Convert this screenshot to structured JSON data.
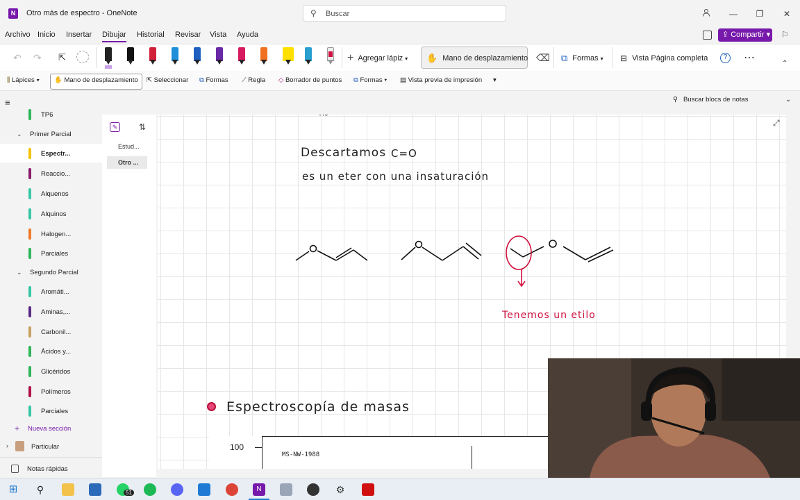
{
  "window": {
    "title": "Otro más de espectro - OneNote",
    "search_placeholder": "Buscar"
  },
  "menu": {
    "items": [
      "Archivo",
      "Inicio",
      "Insertar",
      "Dibujar",
      "Historial",
      "Revisar",
      "Vista",
      "Ayuda"
    ],
    "active": "Dibujar",
    "share_label": "Compartir"
  },
  "ribbon": {
    "add_pen": "Agregar lápiz",
    "hand": "Mano de desplazamiento",
    "shapes": "Formas",
    "full_page": "Vista Página completa",
    "pens": [
      {
        "color": "#222222"
      },
      {
        "color": "#111111"
      },
      {
        "color": "#d0203a"
      },
      {
        "color": "#1e8fd8"
      },
      {
        "color": "#1f5fbf"
      },
      {
        "color": "#6a2aa8"
      },
      {
        "color": "#d81b60"
      },
      {
        "color": "#f07020"
      },
      {
        "color": "#ffe000"
      },
      {
        "color": "#2aa0d0"
      },
      {
        "color": "#d01040"
      }
    ]
  },
  "quick_access": {
    "pencils": "Lápices",
    "hand": "Mano de desplazamiento",
    "select": "Seleccionar",
    "shapes": "Formas",
    "ruler": "Regla",
    "point_eraser": "Borrador de puntos",
    "shapes2": "Formas",
    "print_preview": "Vista previa de impresión"
  },
  "nav": {
    "search_notebooks": "Buscar blocs de notas"
  },
  "sidebar": {
    "top_item": {
      "label": "TP6",
      "color": "#2fb55a"
    },
    "group1": "Primer Parcial",
    "group1_items": [
      {
        "label": "Espectr...",
        "color": "#f2c200",
        "selected": true
      },
      {
        "label": "Reaccio...",
        "color": "#8a1a6b"
      },
      {
        "label": "Alquenos",
        "color": "#38c7a6"
      },
      {
        "label": "Alquinos",
        "color": "#38c7a6"
      },
      {
        "label": "Halogen...",
        "color": "#f07a2a"
      },
      {
        "label": "Parciales",
        "color": "#2fb55a"
      }
    ],
    "group2": "Segundo Parcial",
    "group2_items": [
      {
        "label": "Aromáti...",
        "color": "#38c7a6"
      },
      {
        "label": "Aminas,...",
        "color": "#5b2a86"
      },
      {
        "label": "Carbonil...",
        "color": "#c8a060"
      },
      {
        "label": "Ácidos y...",
        "color": "#2fb55a"
      },
      {
        "label": "Glicéridos",
        "color": "#2fb55a"
      },
      {
        "label": "Polímeros",
        "color": "#b0104a"
      },
      {
        "label": "Parciales",
        "color": "#38c7a6"
      }
    ],
    "new_section": "Nueva sección",
    "notebook": "Particular",
    "quick_notes": "Notas rápidas"
  },
  "pages": {
    "items": [
      "Estud...",
      "Otro ..."
    ],
    "selected": "Otro ..."
  },
  "note": {
    "line1a": "Descartamos",
    "line1b": "C=O",
    "line2": "es un eter con una insaturación",
    "annotation": "Tenemos un etilo",
    "heading": "Espectroscopía de masas",
    "spectrum_top": "100",
    "spectrum_id": "MS-NW-1988"
  },
  "taskbar": {
    "whatsapp_badge": "51"
  }
}
